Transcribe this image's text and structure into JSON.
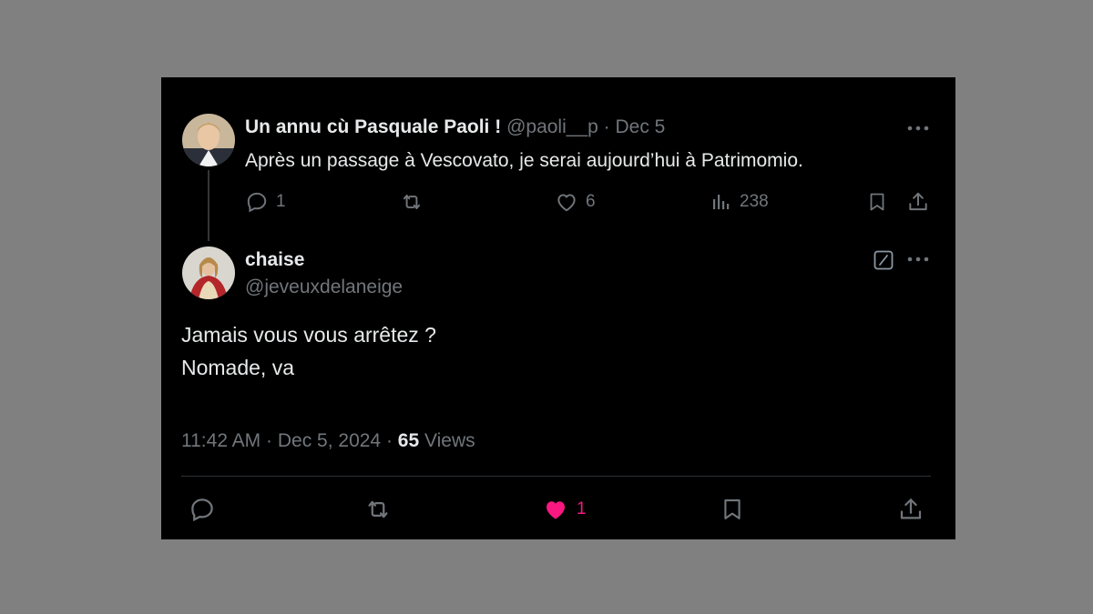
{
  "parent": {
    "name": "Un annu cù Pasquale Paoli !",
    "handle": "@paoli__p",
    "separator": "·",
    "date": "Dec 5",
    "text": "Après un passage à Vescovato, je serai aujourd’hui à Patrimomio.",
    "replies": "1",
    "likes": "6",
    "views": "238",
    "icons": [
      "reply-icon",
      "retweet-icon",
      "like-icon",
      "views-icon",
      "bookmark-icon",
      "share-icon",
      "more-icon"
    ]
  },
  "reply": {
    "name": "chaise",
    "handle": "@jeveuxdelaneige",
    "text_line1": "Jamais vous vous arrêtez ?",
    "text_line2": "Nomade, va",
    "time": "11:42 AM",
    "separator": "·",
    "date": "Dec 5, 2024",
    "separator2": "·",
    "views_count": "65",
    "views_label": "Views",
    "likes": "1",
    "liked": true,
    "icons": [
      "grok-icon",
      "more-icon",
      "reply-icon",
      "retweet-icon",
      "like-icon",
      "bookmark-icon",
      "share-icon"
    ]
  },
  "colors": {
    "background": "#000000",
    "text": "#e7e9ea",
    "muted": "#71767b",
    "like_active": "#f91880",
    "page_bg": "#808080"
  }
}
